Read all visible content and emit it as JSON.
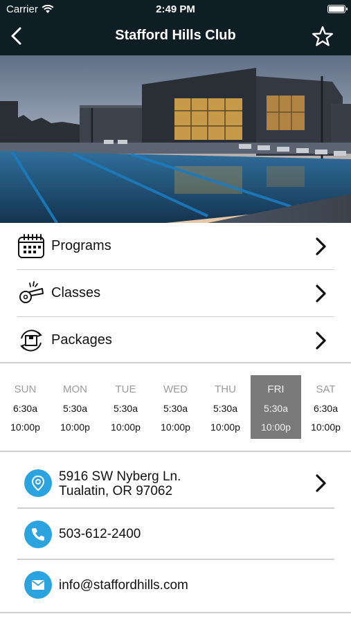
{
  "status_bar": {
    "carrier": "Carrier",
    "time": "2:49 PM"
  },
  "nav": {
    "title": "Stafford Hills Club",
    "back_icon": "chevron-left-icon",
    "favorite_icon": "star-outline-icon"
  },
  "menu": [
    {
      "label": "Programs",
      "icon": "calendar-grid-icon"
    },
    {
      "label": "Classes",
      "icon": "whistle-icon"
    },
    {
      "label": "Packages",
      "icon": "package-cycle-icon"
    }
  ],
  "hours": [
    {
      "day": "SUN",
      "open": "6:30a",
      "close": "10:00p"
    },
    {
      "day": "MON",
      "open": "5:30a",
      "close": "10:00p"
    },
    {
      "day": "TUE",
      "open": "5:30a",
      "close": "10:00p"
    },
    {
      "day": "WED",
      "open": "5:30a",
      "close": "10:00p"
    },
    {
      "day": "THU",
      "open": "5:30a",
      "close": "10:00p"
    },
    {
      "day": "FRI",
      "open": "5:30a",
      "close": "10:00p",
      "active": true
    },
    {
      "day": "SAT",
      "open": "6:30a",
      "close": "10:00p"
    }
  ],
  "contact": {
    "address_line1": "5916 SW Nyberg Ln.",
    "address_line2": "Tualatin, OR 97062",
    "phone": "503-612-2400",
    "email": "info@staffordhills.com"
  },
  "colors": {
    "nav_bg": "#0f1e24",
    "accent": "#2aa3de",
    "active_day": "#7a7a7a"
  }
}
